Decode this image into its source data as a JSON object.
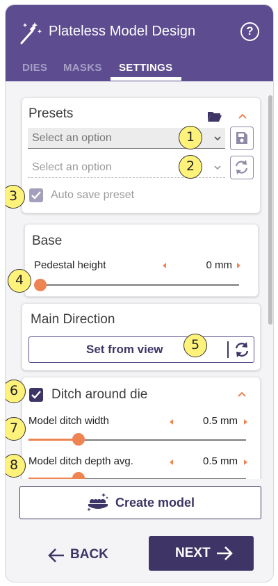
{
  "header": {
    "title": "Plateless Model Design",
    "help_icon": "?",
    "tabs": [
      {
        "label": "DIES",
        "active": false
      },
      {
        "label": "MASKS",
        "active": false
      },
      {
        "label": "SETTINGS",
        "active": true
      }
    ]
  },
  "presets": {
    "title": "Presets",
    "select_1_placeholder": "Select an option",
    "select_2_placeholder": "Select an option",
    "auto_save_label": "Auto save preset",
    "auto_save_checked": true
  },
  "base": {
    "title": "Base",
    "pedestal_label": "Pedestal height",
    "pedestal_value": "0 mm",
    "pedestal_level": 0
  },
  "main_direction": {
    "title": "Main Direction",
    "button_label": "Set from view"
  },
  "ditch": {
    "title": "Ditch around die",
    "checked": true,
    "width_label": "Model ditch width",
    "width_value": "0.5 mm",
    "width_level": 0.23,
    "depth_label": "Model ditch depth avg.",
    "depth_value": "0.5 mm",
    "depth_level": 0.23
  },
  "badges": [
    "1",
    "2",
    "3",
    "4",
    "5",
    "6",
    "7",
    "8"
  ],
  "actions": {
    "create_label": "Create model",
    "back_label": "BACK",
    "next_label": "NEXT"
  },
  "colors": {
    "header": "#5d4d90",
    "accent": "#ee8452",
    "primary_dark": "#3e3566",
    "badge": "#fff27a"
  }
}
